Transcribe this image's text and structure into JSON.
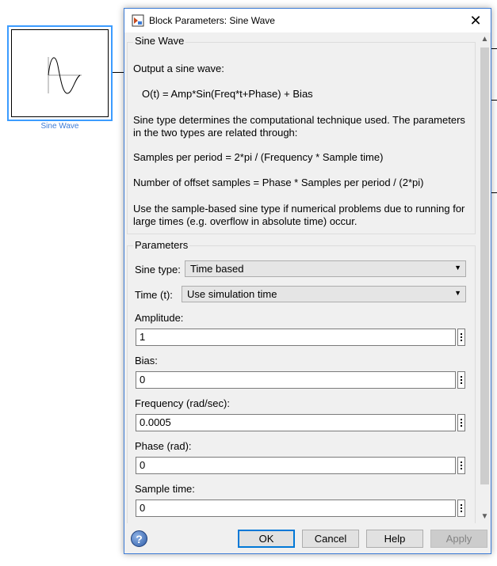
{
  "canvas": {
    "block_label": "Sine Wave"
  },
  "dialog": {
    "title": "Block Parameters: Sine Wave",
    "description_group": {
      "title": "Sine Wave",
      "lines": [
        "Output a sine wave:",
        "O(t) = Amp*Sin(Freq*t+Phase) + Bias",
        "Sine type determines the computational technique used. The parameters",
        "in the two types are related through:",
        "Samples per period = 2*pi / (Frequency * Sample time)",
        "Number of offset samples = Phase * Samples per period / (2*pi)",
        "Use the sample-based sine type if numerical problems due to running for",
        "large times (e.g. overflow in absolute time) occur."
      ]
    },
    "parameters_group": {
      "title": "Parameters",
      "sine_type": {
        "label": "Sine type:",
        "value": "Time based"
      },
      "time": {
        "label": "Time (t):",
        "value": "Use simulation time"
      },
      "amplitude": {
        "label": "Amplitude:",
        "value": "1"
      },
      "bias": {
        "label": "Bias:",
        "value": "0"
      },
      "frequency": {
        "label": "Frequency (rad/sec):",
        "value": "0.0005"
      },
      "phase": {
        "label": "Phase (rad):",
        "value": "0"
      },
      "sample_time": {
        "label": "Sample time:",
        "value": "0"
      }
    },
    "buttons": {
      "ok": "OK",
      "cancel": "Cancel",
      "help": "Help",
      "apply": "Apply"
    }
  },
  "colors": {
    "selection_blue": "#3c9cff",
    "ok_focus": "#0078d7"
  }
}
